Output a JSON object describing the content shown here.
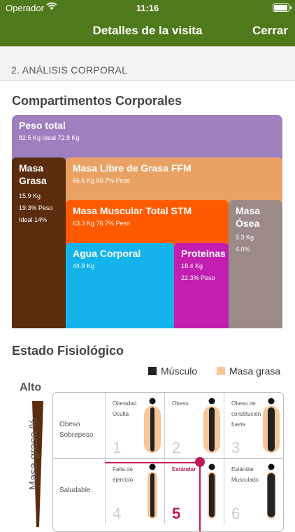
{
  "status": {
    "carrier": "Operador",
    "time": "11:16"
  },
  "nav": {
    "title": "Detalles de la visita",
    "close": "Cerrar"
  },
  "section": {
    "title": "2. ANÁLISIS CORPORAL"
  },
  "compartments": {
    "title": "Compartimentos Corporales",
    "peso_total": {
      "title": "Peso total",
      "line1": "82.5 Kg Ideal 72.8 Kg",
      "color": "#9e7fbf"
    },
    "masa_grasa": {
      "title": "Masa Grasa",
      "line1": "15.9 Kg",
      "line2": "19.3% Peso",
      "line3": "Ideal 14%",
      "color": "#5b2d0e"
    },
    "ffm": {
      "title": "Masa Libre de Grasa FFM",
      "line1": "66.6 Kg 80.7% Peso",
      "color": "#e9a264"
    },
    "stm": {
      "title": "Masa Muscular Total STM",
      "line1": "63.3 Kg 76.7% Peso",
      "color": "#ff5a00"
    },
    "osea": {
      "title": "Masa Ósea",
      "line1": "3.3 Kg",
      "line2": "4.0%",
      "color": "#9b8a88"
    },
    "agua": {
      "title": "Agua Corporal",
      "line1": "44.9 Kg",
      "color": "#15b3eb"
    },
    "proteinas": {
      "title": "Proteinas",
      "line1": "18.4 Kg",
      "line2": "22.3% Peso",
      "color": "#c21fb0"
    }
  },
  "physio": {
    "title": "Estado Fisiológico",
    "legend": [
      {
        "label": "Músculo",
        "color": "#222222"
      },
      {
        "label": "Masa grasa",
        "color": "#f7c79a"
      }
    ],
    "alto": "Alto",
    "ylabel": "Masa grasa %",
    "rows": [
      "Obeso Sobrepeso",
      "Saludable"
    ],
    "cells": [
      {
        "label": "Obesidad Oculta",
        "num": "1"
      },
      {
        "label": "Obeso",
        "num": "2"
      },
      {
        "label": "Obeso de constitución fuerte",
        "num": "3"
      },
      {
        "label": "Falta de ejercicio",
        "num": "4"
      },
      {
        "label": "Estándar",
        "num": "5"
      },
      {
        "label": "Estándar Musculado",
        "num": "6"
      }
    ],
    "selected": "5"
  }
}
